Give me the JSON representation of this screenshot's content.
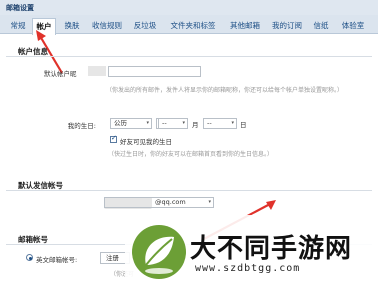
{
  "window": {
    "title": "邮箱设置"
  },
  "tabs": [
    "常规",
    "帐户",
    "换肤",
    "收信规则",
    "反垃圾",
    "文件夹和标签",
    "其他邮箱",
    "我的订阅",
    "信纸",
    "体验室"
  ],
  "account_info": {
    "section_title": "帐户信息",
    "nickname_label": "默认帐户昵",
    "nickname_hint": "（你发出的所有邮件，发件人将显示你的邮箱昵称，你还可以给每个帐户单独设置昵称。）"
  },
  "birthday": {
    "label": "我的生日:",
    "calendar_value": "公历",
    "year_value": "",
    "month_value": "--",
    "month_unit": "月",
    "day_value": "--",
    "day_unit": "日",
    "checkbox_label": "好友可见我的生日",
    "hint": "（快过生日时，你的好友可以在邮箱首页看到你的生日信息。）"
  },
  "default_sender": {
    "section_title": "默认发信帐号",
    "account_value": "@qq.com"
  },
  "mail_accounts": {
    "section_title": "邮箱帐号",
    "english_label": "英文邮箱帐号:",
    "register_button": "注册",
    "hint": "（你还可"
  },
  "watermark": {
    "title": "大不同手游网",
    "url": "www.szdbtgg.com"
  },
  "colors": {
    "accent": "#1d4f86",
    "arrow": "#e0322b",
    "logo": "#6c9f36"
  }
}
